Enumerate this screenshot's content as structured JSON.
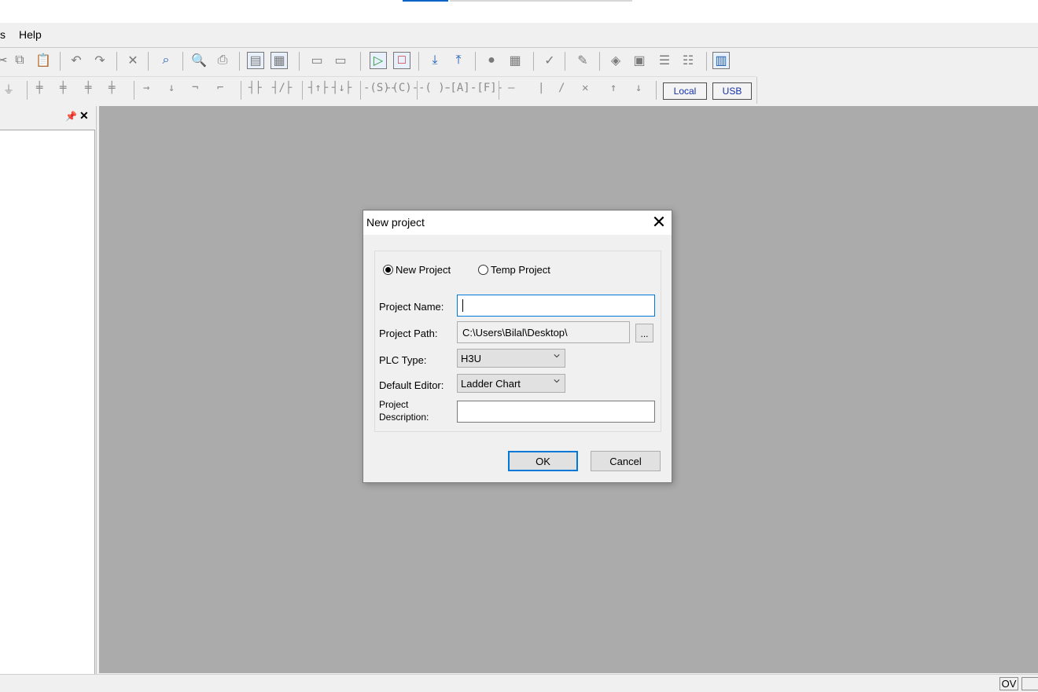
{
  "menu": {
    "items": [
      "s",
      "Help"
    ]
  },
  "toolbar2": {
    "ladder_glyphs": [
      "⏚",
      "╪",
      "╪",
      "╪",
      "╪",
      "→",
      "↓",
      "¬",
      "⌐",
      "┤├",
      "┤/├",
      "┤↑├",
      "┤↓├",
      "-(S)-",
      "-(C)-",
      "-( )-",
      "-[A]-",
      "-[F]-",
      "—",
      "|",
      "/",
      "✕",
      "↑",
      "↓"
    ],
    "local_label": "Local",
    "usb_label": "USB"
  },
  "statusbar": {
    "mode": "OV"
  },
  "dialog": {
    "title": "New project",
    "radio_new": "New Project",
    "radio_temp": "Temp Project",
    "project_name_label": "Project Name:",
    "project_name_value": "",
    "project_path_label": "Project Path:",
    "project_path_value": "C:\\Users\\Bilal\\Desktop\\",
    "browse_label": "...",
    "plc_type_label": "PLC Type:",
    "plc_type_value": "H3U",
    "default_editor_label": "Default Editor:",
    "default_editor_value": "Ladder Chart",
    "project_desc_label_line1": "Project",
    "project_desc_label_line2": "Description:",
    "ok_label": "OK",
    "cancel_label": "Cancel"
  },
  "colors": {
    "accent": "#0078d7",
    "workspace": "#ababab"
  }
}
